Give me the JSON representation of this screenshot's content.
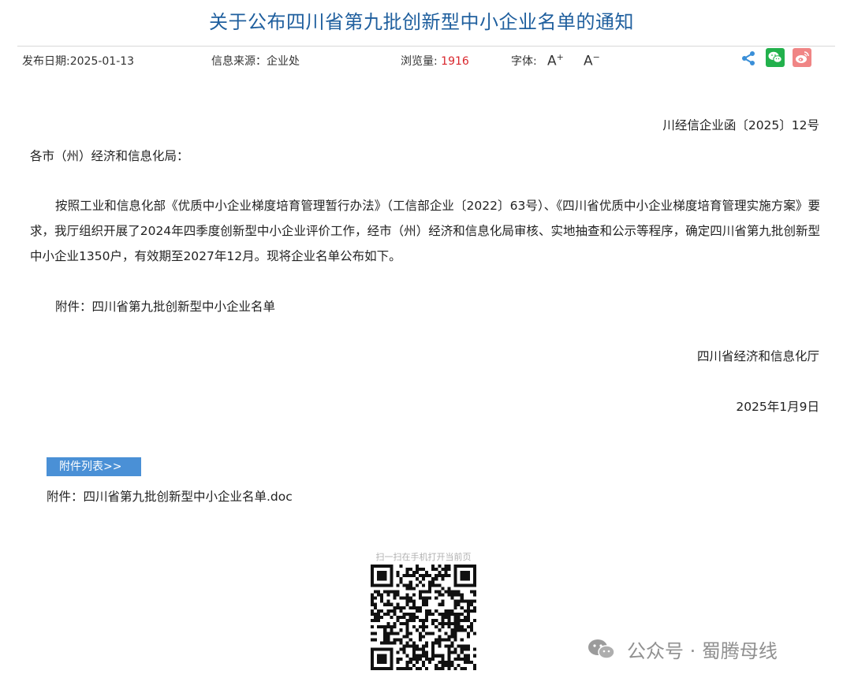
{
  "header": {
    "title": "关于公布四川省第九批创新型中小企业名单的通知"
  },
  "meta": {
    "date_label": "发布日期:",
    "date_value": "2025-01-13",
    "source_label": "信息来源：",
    "source_value": "企业处",
    "views_label": "浏览量:",
    "views_value": "1916",
    "font_label": "字体:",
    "font_up": "A",
    "font_up_sup": "+",
    "font_down": "A",
    "font_down_sup": "−"
  },
  "share": {
    "icons": [
      "share-icon",
      "wechat-icon",
      "weibo-icon"
    ],
    "wechat_color": "#22b14c",
    "weibo_color": "#f08585"
  },
  "article": {
    "doc_number": "川经信企业函〔2025〕12号",
    "salutation": "各市（州）经济和信息化局：",
    "paragraph": "按照工业和信息化部《优质中小企业梯度培育管理暂行办法》（工信部企业〔2022〕63号）、《四川省优质中小企业梯度培育管理实施方案》要求，我厅组织开展了2024年四季度创新型中小企业评价工作，经市（州）经济和信息化局审核、实地抽查和公示等程序，确定四川省第九批创新型中小企业1350户，有效期至2027年12月。现将企业名单公布如下。",
    "attachment_line": "附件：四川省第九批创新型中小企业名单",
    "signature_org": "四川省经济和信息化厅",
    "signature_date": "2025年1月9日"
  },
  "attachments": {
    "tab_label": "附件列表>>",
    "file_label": "附件：四川省第九批创新型中小企业名单.doc"
  },
  "qr": {
    "caption": "扫一扫在手机打开当前页"
  },
  "watermark": {
    "text": "公众号 · 蜀腾母线"
  },
  "colors": {
    "title": "#1f5f9e",
    "views_number": "#d9262c",
    "attach_tab": "#4a90d6"
  }
}
